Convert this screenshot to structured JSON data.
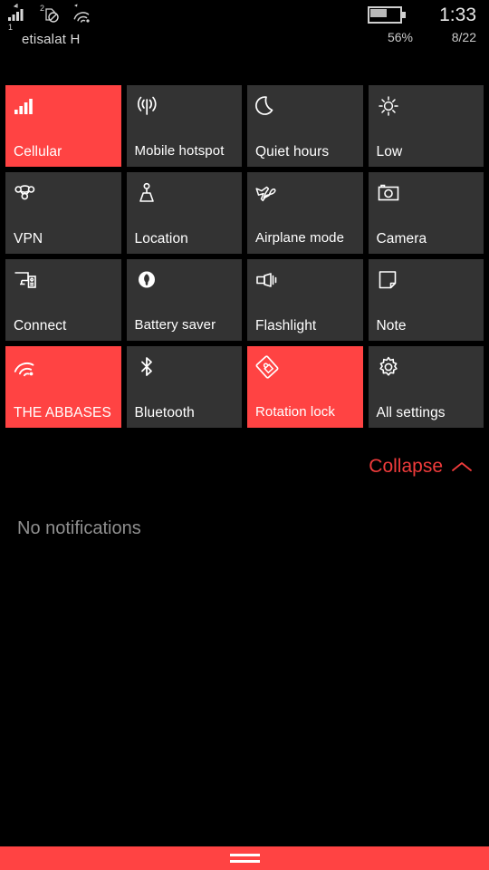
{
  "statusbar": {
    "signal_icon": "cellular-signal-icon",
    "sim1_label": "1",
    "sim2_label": "2",
    "sim2_icon": "sim-no-service-icon",
    "wifi_icon": "wifi-signal-icon",
    "roaming_icon": "roaming-arrow-icon",
    "carrier": "etisalat H",
    "battery_icon": "battery-icon",
    "battery_percent": "56%",
    "battery_level": 56,
    "clock": "1:33",
    "date": "8/22"
  },
  "tiles": [
    {
      "label": "Cellular",
      "icon": "cellular-bars-icon",
      "state": "on"
    },
    {
      "label": "Mobile hotspot",
      "icon": "hotspot-icon",
      "state": "off"
    },
    {
      "label": "Quiet hours",
      "icon": "moon-icon",
      "state": "off"
    },
    {
      "label": "Low",
      "icon": "brightness-sun-icon",
      "state": "off"
    },
    {
      "label": "VPN",
      "icon": "vpn-knot-icon",
      "state": "off"
    },
    {
      "label": "Location",
      "icon": "location-beacon-icon",
      "state": "off"
    },
    {
      "label": "Airplane mode",
      "icon": "airplane-icon",
      "state": "off"
    },
    {
      "label": "Camera",
      "icon": "camera-icon",
      "state": "off"
    },
    {
      "label": "Connect",
      "icon": "connect-display-icon",
      "state": "off"
    },
    {
      "label": "Battery saver",
      "icon": "battery-leaf-icon",
      "state": "off"
    },
    {
      "label": "Flashlight",
      "icon": "flashlight-icon",
      "state": "off"
    },
    {
      "label": "Note",
      "icon": "note-page-icon",
      "state": "off"
    },
    {
      "label": "THE ABBASES",
      "icon": "wifi-icon",
      "state": "on"
    },
    {
      "label": "Bluetooth",
      "icon": "bluetooth-icon",
      "state": "off"
    },
    {
      "label": "Rotation lock",
      "icon": "rotation-lock-icon",
      "state": "on"
    },
    {
      "label": "All settings",
      "icon": "gear-icon",
      "state": "off"
    }
  ],
  "collapse": {
    "label": "Collapse",
    "icon": "chevron-up-icon"
  },
  "notifications": {
    "empty_text": "No notifications"
  },
  "navbar": {
    "handle_icon": "drag-handle-icon"
  },
  "colors": {
    "accent": "#ff4343",
    "tile_off": "#333333",
    "background": "#000000",
    "text": "#ffffff",
    "muted_text": "#8f8f8f"
  }
}
